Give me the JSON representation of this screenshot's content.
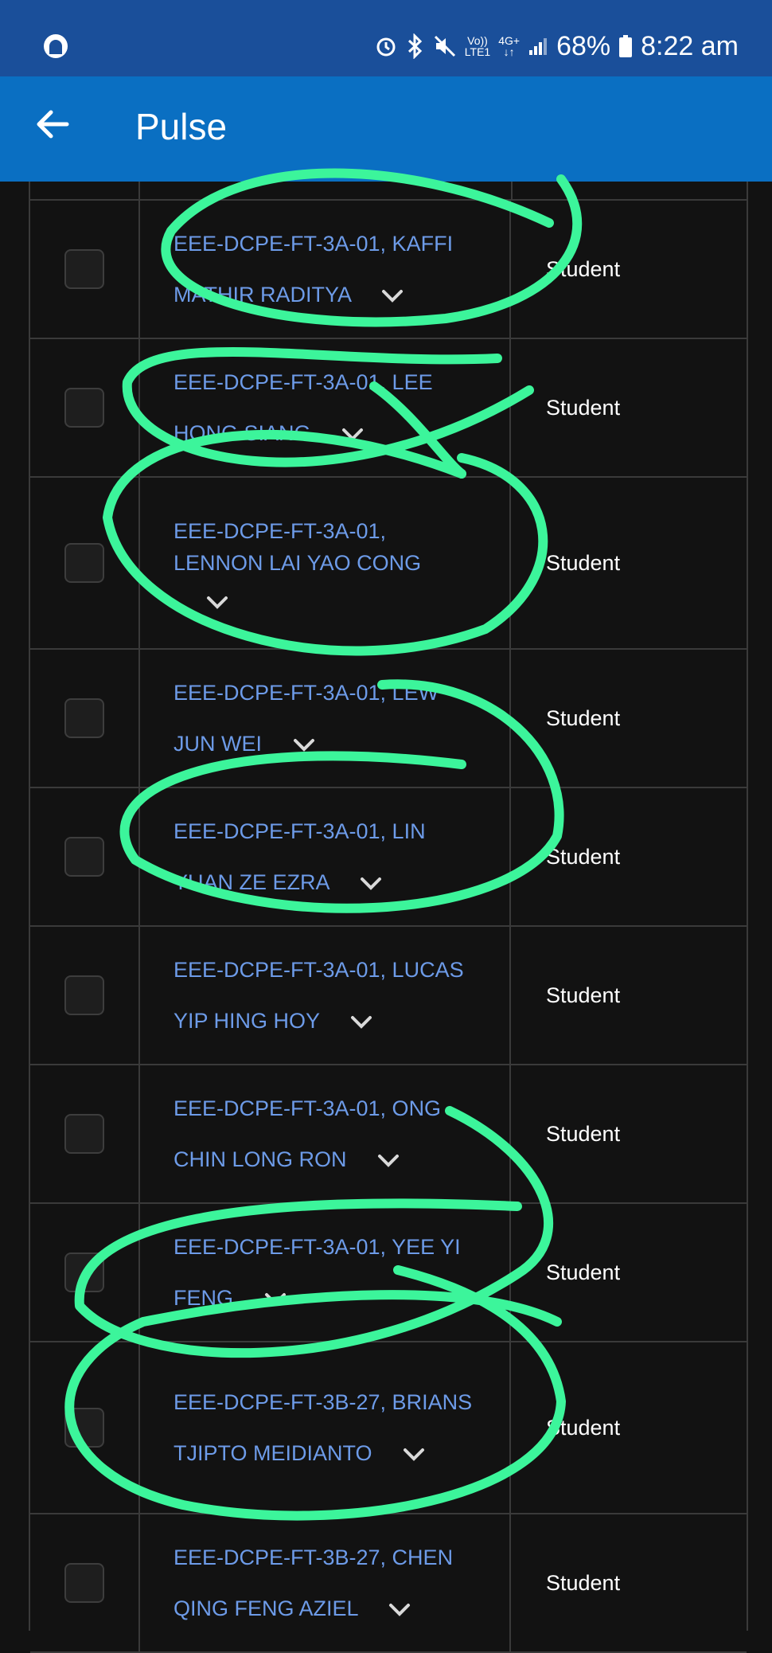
{
  "status_bar": {
    "network_top": "Vo))",
    "network_bottom": "LTE1",
    "signal_gen": "4G+",
    "battery": "68%",
    "time": "8:22 am"
  },
  "app_bar": {
    "title": "Pulse"
  },
  "rows": [
    {
      "line1": "EEE-DCPE-FT-3A-01, KAFFI",
      "line2": "MATHIR RADITYA",
      "role": "Student"
    },
    {
      "line1": "EEE-DCPE-FT-3A-01, LEE",
      "line2": "HONG SIANG",
      "role": "Student"
    },
    {
      "line1": "EEE-DCPE-FT-3A-01,",
      "line2": "LENNON LAI YAO CONG",
      "role": "Student"
    },
    {
      "line1": "EEE-DCPE-FT-3A-01, LEW",
      "line2": "JUN WEI",
      "role": "Student"
    },
    {
      "line1": "EEE-DCPE-FT-3A-01, LIN",
      "line2": "YUAN ZE EZRA",
      "role": "Student"
    },
    {
      "line1": "EEE-DCPE-FT-3A-01, LUCAS",
      "line2": "YIP HING HOY",
      "role": "Student"
    },
    {
      "line1": "EEE-DCPE-FT-3A-01, ONG",
      "line2": "CHIN LONG RON",
      "role": "Student"
    },
    {
      "line1": "EEE-DCPE-FT-3A-01, YEE YI",
      "line2": "FENG",
      "role": "Student"
    },
    {
      "line1": "EEE-DCPE-FT-3B-27, BRIANS",
      "line2": "TJIPTO MEIDIANTO",
      "role": "Student"
    },
    {
      "line1": "EEE-DCPE-FT-3B-27, CHEN",
      "line2": "QING FENG AZIEL",
      "role": "Student"
    }
  ],
  "colors": {
    "status_bar": "#1a4f9a",
    "app_bar": "#0a6fc2",
    "background": "#121212",
    "name_link": "#6d9be8",
    "annotation": "#3cf59b"
  }
}
